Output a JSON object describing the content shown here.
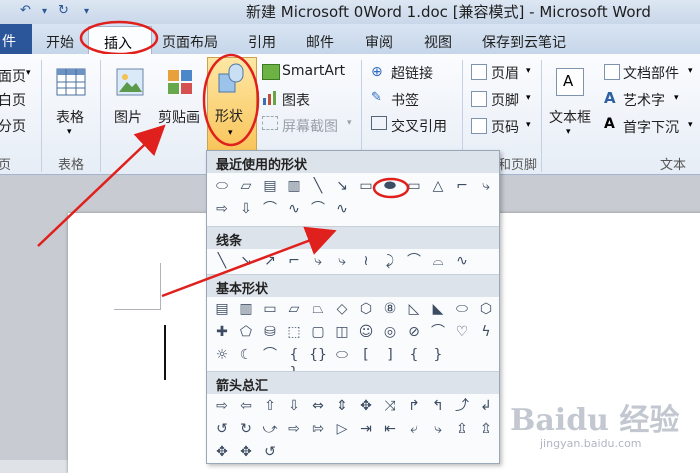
{
  "titlebar": {
    "title": "新建 Microsoft 0Word 1.doc [兼容模式] - Microsoft Word",
    "icons": [
      "undo-icon",
      "redo-icon",
      "customize-quick-access-icon"
    ]
  },
  "tabs": {
    "file": "件",
    "items": [
      "开始",
      "插入",
      "页面布局",
      "引用",
      "邮件",
      "审阅",
      "视图",
      "保存到云笔记"
    ],
    "active": "插入"
  },
  "ribbon": {
    "pages": {
      "cover": "面页",
      "blank": "白页",
      "break": "分页",
      "group": "页"
    },
    "tables": {
      "label": "表格",
      "group": "表格"
    },
    "illustrations": {
      "picture": "图片",
      "clipart": "剪贴画",
      "shapes": "形状",
      "smartart": "SmartArt",
      "chart": "图表",
      "screenshot": "屏幕截图"
    },
    "links": {
      "hyperlink": "超链接",
      "bookmark": "书签",
      "crossref": "交叉引用"
    },
    "header_footer": {
      "header": "页眉",
      "footer": "页脚",
      "page_number": "页码",
      "group": "和页脚"
    },
    "text": {
      "textbox": "文本框",
      "quick_parts": "文档部件",
      "wordart": "艺术字",
      "dropcap": "首字下沉",
      "group": "文本"
    }
  },
  "gallery": {
    "sections": [
      {
        "title": "最近使用的形状",
        "symbols": [
          "⬭",
          "▱",
          "▤",
          "▥",
          "╲",
          "↘",
          "▭",
          "⬬",
          "▭",
          "△",
          "⌐",
          "⤷",
          "⇨",
          "⇩",
          "⌒",
          "∿",
          "⌒",
          "∿"
        ]
      },
      {
        "title": "线条",
        "symbols": [
          "╲",
          "↘",
          "↗",
          "⌐",
          "⤷",
          "⤷",
          "≀",
          "⤸",
          "⌒",
          "⌓",
          "∿"
        ]
      },
      {
        "title": "基本形状",
        "symbols": [
          "▤",
          "▥",
          "▭",
          "▱",
          "⏢",
          "◇",
          "⬡",
          "⑧",
          "◺",
          "◣",
          "⬭",
          "⬡",
          "✚",
          "⬠",
          "⛁",
          "⬚",
          "▢",
          "◫",
          "☺",
          "◎",
          "⊘",
          "⌒",
          "♡",
          "ϟ",
          "☼",
          "☾",
          "⌒",
          "{ }",
          "{}",
          "⬭",
          "[",
          "]",
          "{",
          "}"
        ]
      },
      {
        "title": "箭头总汇",
        "symbols": [
          "⇨",
          "⇦",
          "⇧",
          "⇩",
          "⇔",
          "⇕",
          "✥",
          "⤨",
          "↱",
          "↰",
          "⤴",
          "↲",
          "↺",
          "↻",
          "⤻",
          "⇨",
          "⇰",
          "▷",
          "⇥",
          "⇤",
          "⤶",
          "⤷",
          "⇫",
          "⇬",
          "✥",
          "✥",
          "↺"
        ]
      }
    ]
  },
  "watermark": {
    "logo": "Baidu 经验",
    "url": "jingyan.baidu.com"
  }
}
